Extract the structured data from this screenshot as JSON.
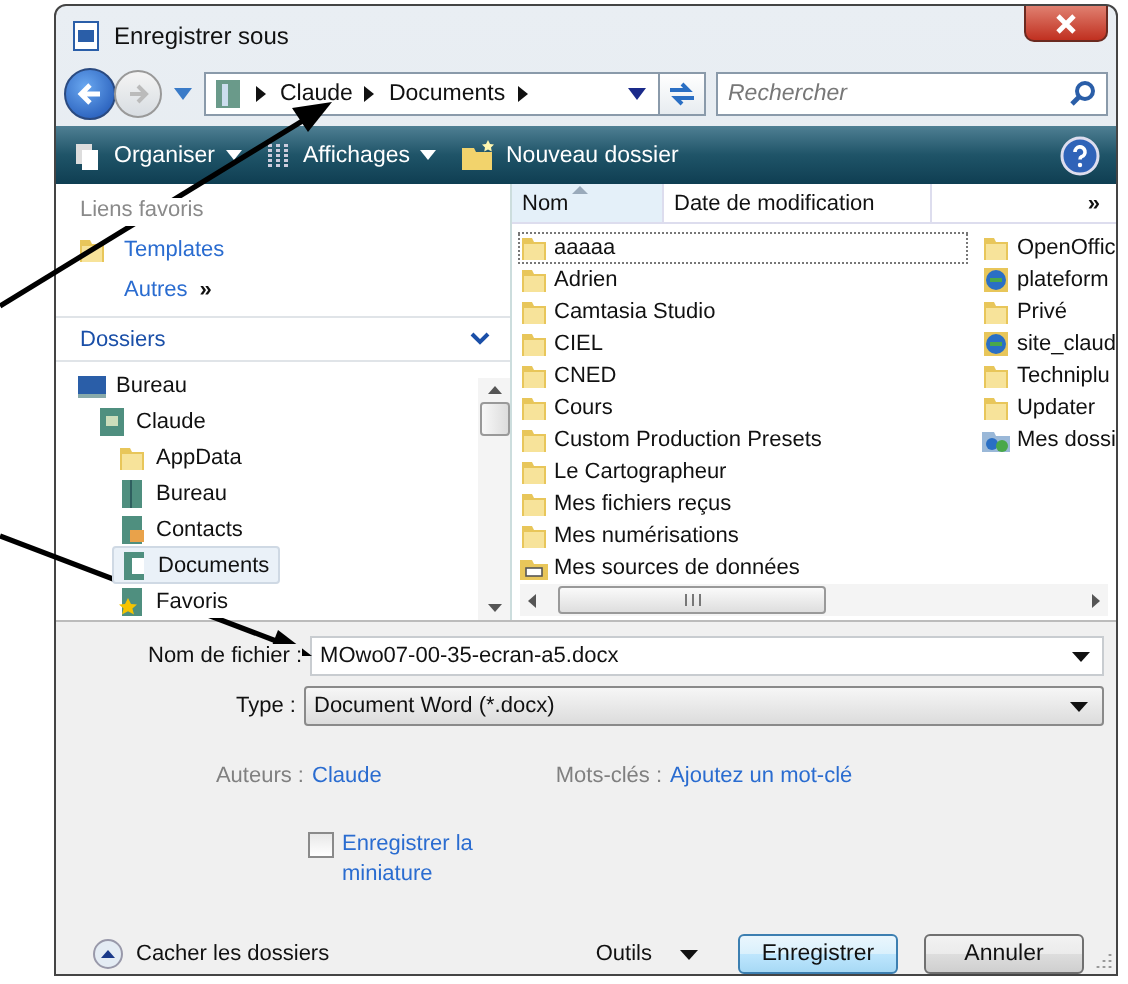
{
  "window": {
    "title": "Enregistrer sous"
  },
  "address": {
    "path": [
      "Claude",
      "Documents"
    ],
    "search_placeholder": "Rechercher"
  },
  "toolbar": [
    {
      "label": "Organiser",
      "kind": "menu"
    },
    {
      "label": "Affichages",
      "kind": "views"
    },
    {
      "label": "Nouveau dossier",
      "kind": "newfolder"
    }
  ],
  "favorites": {
    "heading": "Liens favoris",
    "items": [
      {
        "label": "Templates"
      }
    ],
    "more": "Autres",
    "more_icon": "»"
  },
  "folders": {
    "heading": "Dossiers",
    "tree": [
      {
        "label": "Bureau",
        "kind": "desktop",
        "selected": false,
        "children": [
          {
            "label": "Claude",
            "kind": "user",
            "selected": false,
            "children": [
              {
                "label": "AppData",
                "kind": "folder",
                "selected": false
              },
              {
                "label": "Bureau",
                "kind": "library",
                "selected": false
              },
              {
                "label": "Contacts",
                "kind": "contacts",
                "selected": false
              },
              {
                "label": "Documents",
                "kind": "documents",
                "selected": true
              },
              {
                "label": "Favoris",
                "kind": "favorites",
                "selected": false
              }
            ]
          }
        ]
      }
    ]
  },
  "file_list": {
    "columns": [
      "Nom",
      "Date de modification"
    ],
    "more_columns": "»",
    "items": [
      {
        "name": "aaaaa",
        "kind": "folder",
        "selected": true
      },
      {
        "name": "Adrien",
        "kind": "folder",
        "selected": false
      },
      {
        "name": "Camtasia Studio",
        "kind": "folder",
        "selected": false
      },
      {
        "name": "CIEL",
        "kind": "folder",
        "selected": false
      },
      {
        "name": "CNED",
        "kind": "folder",
        "selected": false
      },
      {
        "name": "Cours",
        "kind": "folder",
        "selected": false
      },
      {
        "name": "Custom Production Presets",
        "kind": "folder",
        "selected": false
      },
      {
        "name": "Le Cartographeur",
        "kind": "folder",
        "selected": false
      },
      {
        "name": "Mes fichiers reçus",
        "kind": "folder",
        "selected": false
      },
      {
        "name": "Mes numérisations",
        "kind": "folder",
        "selected": false
      },
      {
        "name": "Mes sources de données",
        "kind": "datasource",
        "selected": false
      },
      {
        "name": "OpenOffic",
        "kind": "folder",
        "selected": false
      },
      {
        "name": "plateform",
        "kind": "web",
        "selected": false
      },
      {
        "name": "Privé",
        "kind": "folder",
        "selected": false
      },
      {
        "name": "site_claud",
        "kind": "web",
        "selected": false
      },
      {
        "name": "Techniplu",
        "kind": "folder",
        "selected": false
      },
      {
        "name": "Updater",
        "kind": "folder",
        "selected": false
      },
      {
        "name": "Mes dossi",
        "kind": "shared",
        "selected": false
      }
    ]
  },
  "form": {
    "filename": {
      "label": "Nom de fichier :",
      "value": "MOwo07-00-35-ecran-a5.docx"
    },
    "type": {
      "label": "Type :",
      "value": "Document Word (*.docx)"
    },
    "authors": {
      "label": "Auteurs :",
      "value": "Claude"
    },
    "keywords": {
      "label": "Mots-clés :",
      "value": "Ajoutez un mot-clé"
    },
    "thumbnail": {
      "label": "Enregistrer la miniature",
      "checked": false
    }
  },
  "footer": {
    "hide_folders": "Cacher les dossiers",
    "tools": "Outils",
    "save": "Enregistrer",
    "cancel": "Annuler"
  }
}
